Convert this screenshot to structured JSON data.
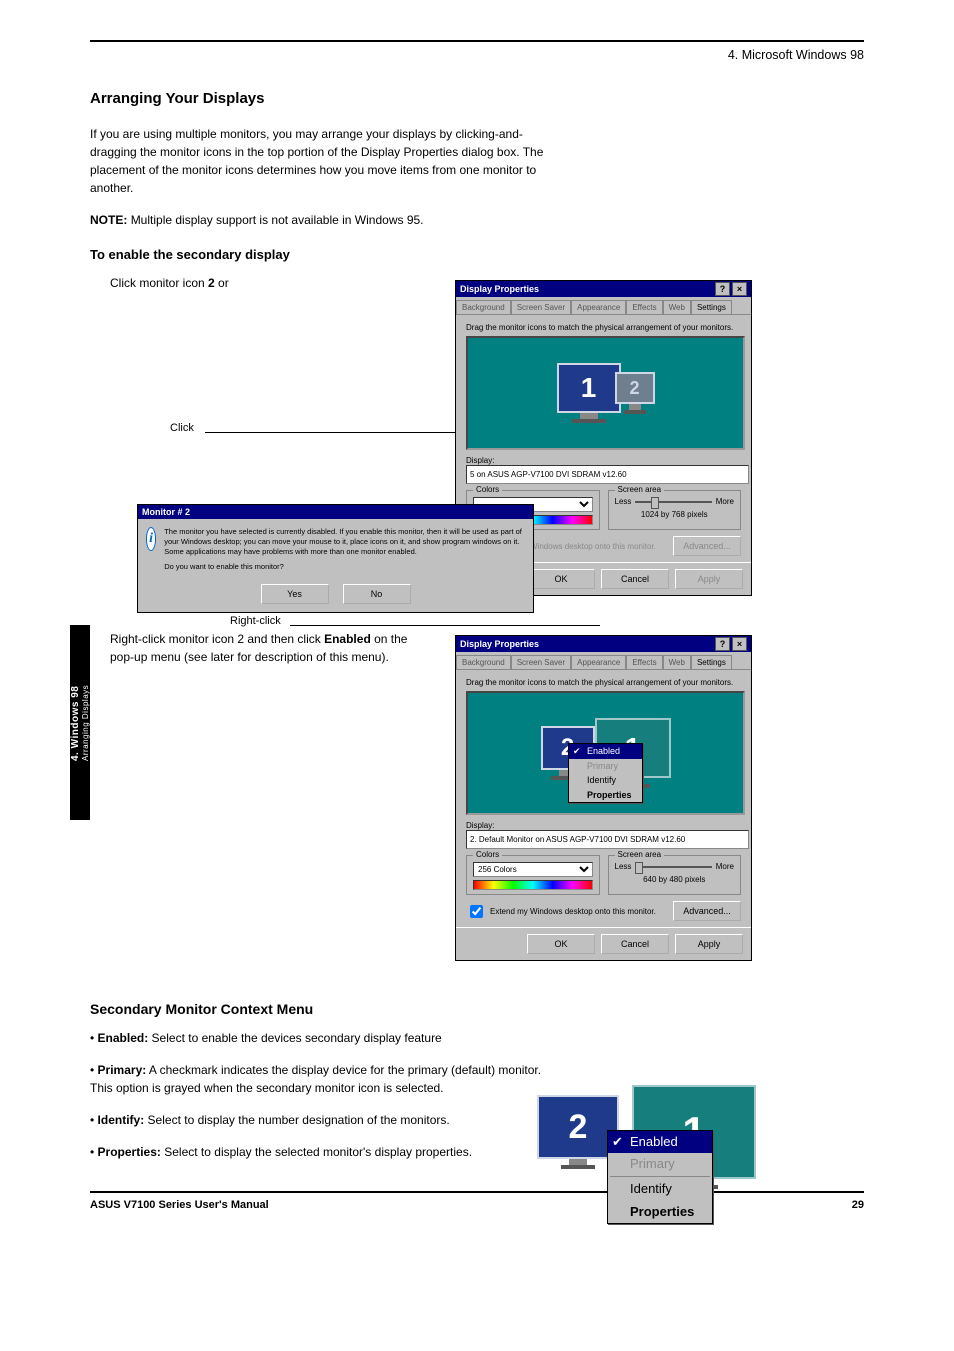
{
  "header": {
    "title": "4. Microsoft Windows 98"
  },
  "intro": {
    "heading": "Arranging Your Displays",
    "p1": "If you are using multiple monitors, you may arrange your displays by clicking-and-dragging the monitor icons in the top portion of the Display Properties dialog box. The placement of the monitor icons determines how you move items from one monitor to another.",
    "p2": "NOTE: Multiple display support is not available in Windows 95."
  },
  "enable": {
    "heading": "To enable the secondary display",
    "step1_a": "Click monitor icon ",
    "step1_b": "2",
    "step1_c": " or",
    "step2_a": "Right-click monitor icon 2 and then click ",
    "step2_b": "Enabled",
    "step2_c": " on the pop-up menu (see later for description of this menu).",
    "click_label": "Click",
    "rightclick_label": "Right-click"
  },
  "dialog": {
    "title": "Display Properties",
    "tabs": [
      "Background",
      "Screen Saver",
      "Appearance",
      "Effects",
      "Web",
      "Settings"
    ],
    "hint": "Drag the monitor icons to match the physical arrangement of your monitors.",
    "display_label": "Display:",
    "dp1_display": "5 on ASUS AGP-V7100 DVI SDRAM v12.60",
    "dp2_display": "2. Default Monitor on ASUS AGP-V7100 DVI SDRAM v12.60",
    "colors_label": "Colors",
    "dp1_colors": "",
    "dp2_colors": "256 Colors",
    "screen_area_label": "Screen area",
    "less": "Less",
    "more": "More",
    "dp1_res": "1024 by 768 pixels",
    "dp2_res": "640 by 480 pixels",
    "extend_chk_dis": "Extend my Windows desktop onto this monitor.",
    "extend_chk": "Extend my Windows desktop onto this monitor.",
    "advanced": "Advanced...",
    "ok": "OK",
    "cancel": "Cancel",
    "apply": "Apply"
  },
  "msgbox": {
    "title": "Monitor # 2",
    "text": "The monitor you have selected is currently disabled. If you enable this monitor, then it will be used as part of your Windows desktop; you can move your mouse to it, place icons on it, and show program windows on it. Some applications may have problems with more than one monitor enabled.",
    "prompt": "Do you want to enable this monitor?",
    "yes": "Yes",
    "no": "No"
  },
  "context": {
    "enabled": "Enabled",
    "primary": "Primary",
    "identify": "Identify",
    "properties": "Properties"
  },
  "side_tab": {
    "l1": "4. Windows 98",
    "l2": "Arranging Displays"
  },
  "ctxmenu": {
    "heading": "Secondary Monitor Context Menu",
    "enabled_l": "Enabled:",
    "enabled_t": " Select to enable the devices secondary display feature",
    "primary_l": "Primary:",
    "primary_t": " A checkmark indicates the display device for the primary (default) monitor. This option is grayed when the secondary monitor icon is selected.",
    "identify_l": "Identify:",
    "identify_t": " Select to display the number designation of the monitors.",
    "properties_l": "Properties:",
    "properties_t": " Select to display the selected monitor's display properties."
  },
  "footer": {
    "left": "ASUS V7100 Series User's Manual",
    "right": "29"
  }
}
